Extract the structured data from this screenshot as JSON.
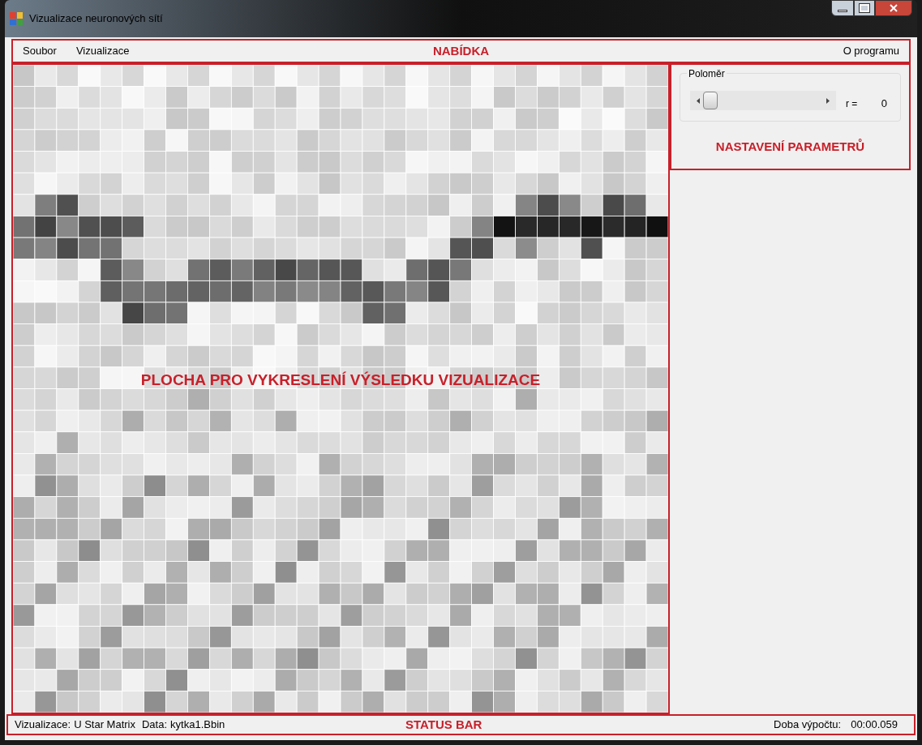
{
  "window": {
    "title": "Vizualizace neuronových sítí"
  },
  "menu": {
    "items": [
      {
        "label": "Soubor"
      },
      {
        "label": "Vizualizace"
      }
    ],
    "right_item": {
      "label": "O programu"
    }
  },
  "settings": {
    "group_title": "Poloměr",
    "reading_label": "r =",
    "reading": "0"
  },
  "status_bar": {
    "visualization_label": "Vizualizace:",
    "visualization": "U Star Matrix",
    "data_label": "Data:",
    "data": "kytka1.Bbin",
    "time_label": "Doba výpočtu:",
    "time": "00:00.059"
  },
  "annotations": {
    "menu": "NABÍDKA",
    "settings": "NASTAVENÍ PARAMETRŮ",
    "canvas": "PLOCHA PRO VYKRESLENÍ VÝSLEDKU VIZUALIZACE",
    "status": "STATUS BAR"
  }
}
